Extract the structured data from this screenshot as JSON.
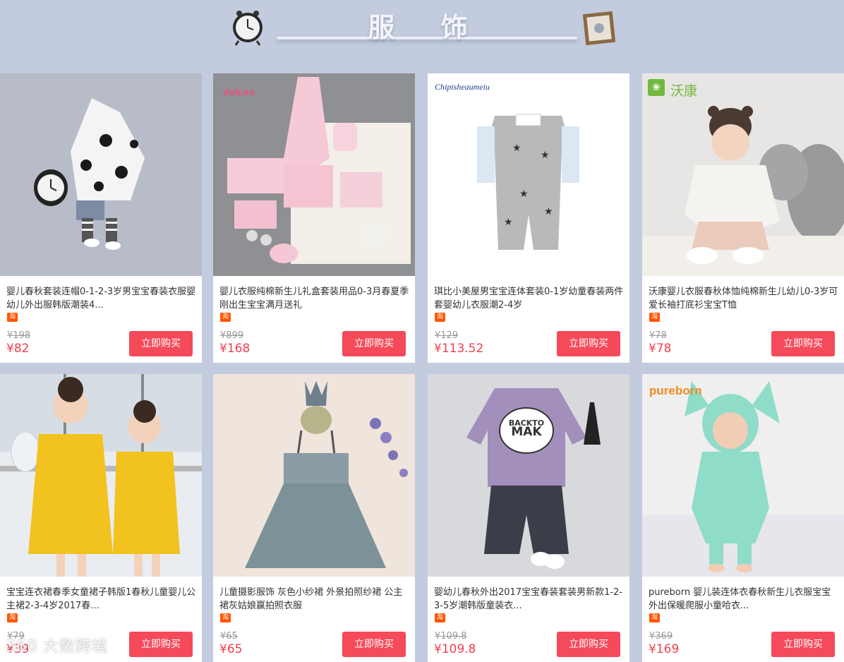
{
  "section": {
    "title": "服 饰"
  },
  "taobao_badge": "淘",
  "buy_label": "立即购买",
  "products": [
    {
      "title": "婴儿春秋套装连帽0-1-2-3岁男宝宝春装衣服婴幼儿外出服韩版潮装4...",
      "original_price": "¥198",
      "price": "¥82",
      "image": "baby-hoodie-polka-dot-set",
      "brand_logo": ""
    },
    {
      "title": "婴儿衣服纯棉新生儿礼盒套装用品0-3月春夏季 刚出生宝宝满月送礼",
      "original_price": "¥899",
      "price": "¥168",
      "image": "pink-newborn-gift-box",
      "brand_logo": "dulcea"
    },
    {
      "title": "琪比小美屋男宝宝连体套装0-1岁幼童春装两件套婴幼儿衣服潮2-4岁",
      "original_price": "¥129",
      "price": "¥113.52",
      "image": "grey-star-romper",
      "brand_logo": "Chipisheaumeiu"
    },
    {
      "title": "沃康婴儿衣服春秋体恤纯棉新生儿幼儿0-3岁可爱长袖打底衫宝宝T恤",
      "original_price": "¥78",
      "price": "¥78",
      "image": "baby-in-bear-hat",
      "brand_logo": "沃康"
    },
    {
      "title": "宝宝连衣裙春季女童裙子韩版1春秋儿童婴儿公主裙2-3-4岁2017春...",
      "original_price": "¥79",
      "price": "¥39",
      "image": "yellow-dress-girls",
      "brand_logo": ""
    },
    {
      "title": "儿童摄影服饰 灰色小纱裙 外景拍照纱裙 公主裙灰姑娘赢拍照衣服",
      "original_price": "¥65",
      "price": "¥65",
      "image": "grey-tutu-dress-crown",
      "brand_logo": ""
    },
    {
      "title": "婴幼儿春秋外出2017宝宝春装套装男新款1-2-3-5岁潮韩版童装衣...",
      "original_price": "¥109.8",
      "price": "¥109.8",
      "image": "purple-sweatshirt-set",
      "brand_logo": ""
    },
    {
      "title": "pureborn 婴儿装连体衣春秋新生儿衣服宝宝外出保暖爬服小童哈衣...",
      "original_price": "¥369",
      "price": "¥169",
      "image": "mint-bunny-romper",
      "brand_logo": "pureborn"
    }
  ],
  "watermark": "360 大数跨境",
  "colors": {
    "page_bg": "#c3cbde",
    "price": "#f0404e",
    "button": "#f44a5a",
    "badge": "#ff5500"
  }
}
